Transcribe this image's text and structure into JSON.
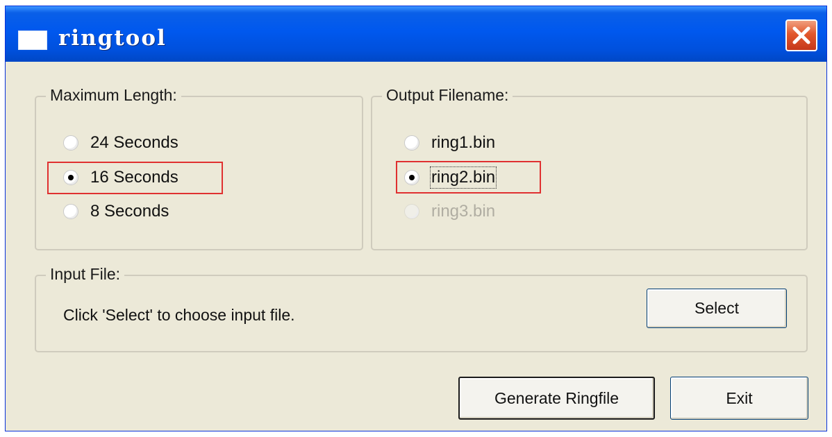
{
  "window": {
    "title": "ringtool",
    "close_glyph": "✕"
  },
  "max_length": {
    "legend": "Maximum Length:",
    "options": [
      {
        "label": "24 Seconds",
        "selected": false,
        "enabled": true
      },
      {
        "label": "16 Seconds",
        "selected": true,
        "enabled": true
      },
      {
        "label": "8 Seconds",
        "selected": false,
        "enabled": true
      }
    ]
  },
  "output_filename": {
    "legend": "Output Filename:",
    "options": [
      {
        "label": "ring1.bin",
        "selected": false,
        "enabled": true
      },
      {
        "label": "ring2.bin",
        "selected": true,
        "enabled": true
      },
      {
        "label": "ring3.bin",
        "selected": false,
        "enabled": false
      }
    ]
  },
  "input_file": {
    "legend": "Input File:",
    "status_text": "Click 'Select' to choose input file.",
    "select_label": "Select"
  },
  "footer": {
    "generate_label": "Generate Ringfile",
    "exit_label": "Exit"
  },
  "colors": {
    "titlebar": "#0058ee",
    "dialog_bg": "#ece9d8",
    "highlight_box": "#e03030",
    "close_button": "#e2572c"
  }
}
